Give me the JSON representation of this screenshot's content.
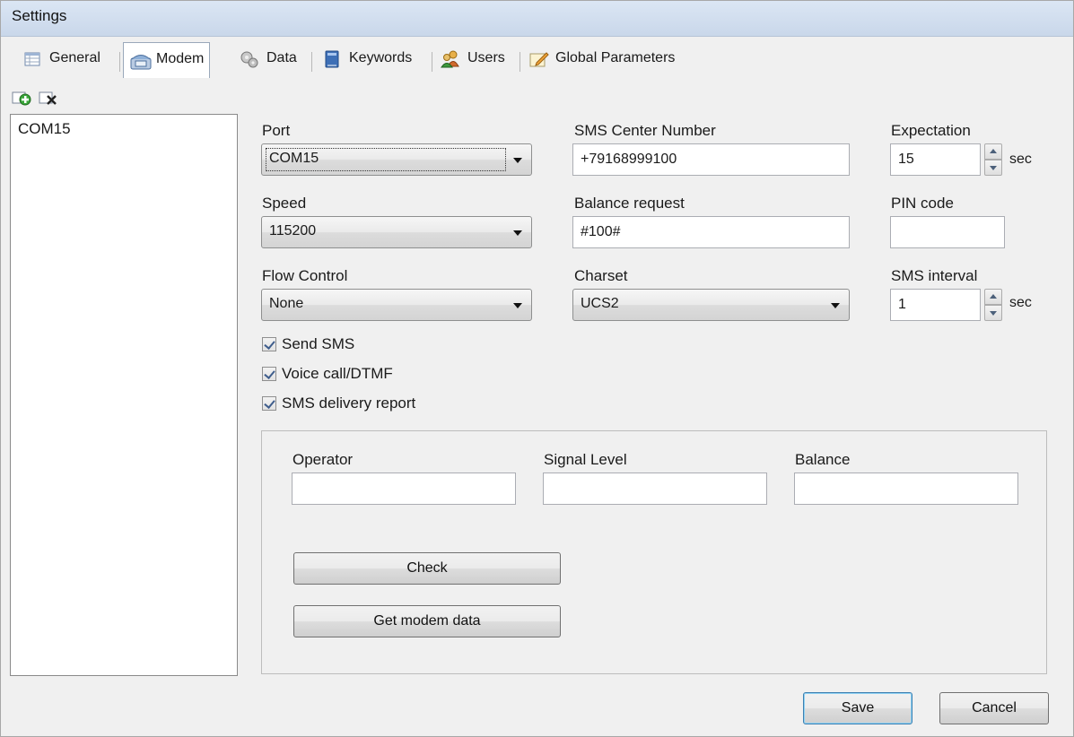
{
  "window": {
    "title": "Settings"
  },
  "tabs": [
    {
      "label": "General",
      "icon": "table-icon"
    },
    {
      "label": "Modem",
      "icon": "phone-icon"
    },
    {
      "label": "Data",
      "icon": "gears-icon"
    },
    {
      "label": "Keywords",
      "icon": "book-icon"
    },
    {
      "label": "Users",
      "icon": "users-icon"
    },
    {
      "label": "Global Parameters",
      "icon": "pencil-icon"
    }
  ],
  "active_tab": "Modem",
  "toolbar": {
    "add_icon": "add-modem-icon",
    "remove_icon": "remove-modem-icon"
  },
  "modems": [
    "COM15"
  ],
  "form": {
    "port": {
      "label": "Port",
      "value": "COM15"
    },
    "speed": {
      "label": "Speed",
      "value": "115200"
    },
    "flow_control": {
      "label": "Flow Control",
      "value": "None"
    },
    "sms_center": {
      "label": "SMS Center Number",
      "value": "+79168999100"
    },
    "balance_request": {
      "label": "Balance request",
      "value": "#100#"
    },
    "charset": {
      "label": "Charset",
      "value": "UCS2"
    },
    "expectation": {
      "label": "Expectation",
      "value": "15",
      "unit": "sec"
    },
    "pin_code": {
      "label": "PIN code",
      "value": ""
    },
    "sms_interval": {
      "label": "SMS interval",
      "value": "1",
      "unit": "sec"
    },
    "send_sms": {
      "label": "Send SMS",
      "checked": true
    },
    "voice_call": {
      "label": "Voice call/DTMF",
      "checked": true
    },
    "delivery_report": {
      "label": "SMS delivery report",
      "checked": true
    }
  },
  "status": {
    "operator": {
      "label": "Operator",
      "value": ""
    },
    "signal_level": {
      "label": "Signal Level",
      "value": ""
    },
    "balance": {
      "label": "Balance",
      "value": ""
    },
    "check_label": "Check",
    "get_data_label": "Get modem data"
  },
  "footer": {
    "save_label": "Save",
    "cancel_label": "Cancel"
  }
}
